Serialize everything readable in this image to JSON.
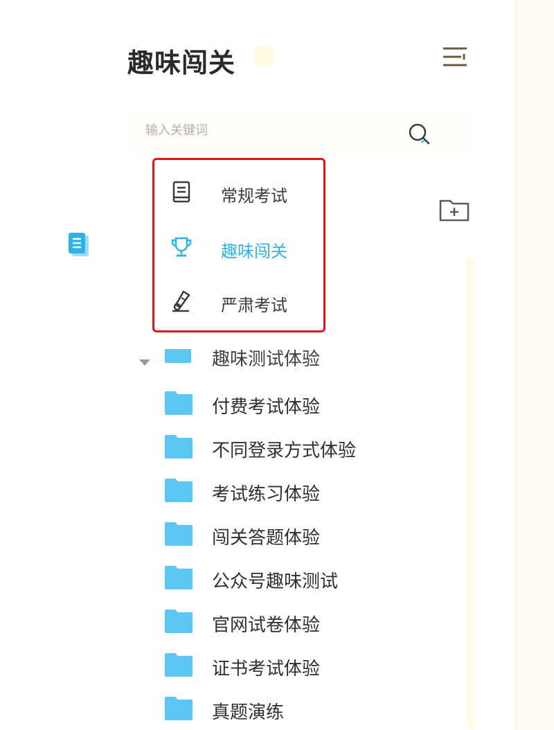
{
  "header": {
    "title": "趣味闯关"
  },
  "search": {
    "placeholder": "输入关键词"
  },
  "colors": {
    "accent": "#2cb3ea",
    "highlight_border": "#e1141b",
    "folder": "#5cc6f5",
    "icon_stroke": "#5a4a30"
  },
  "mode_menu": {
    "items": [
      {
        "label": "常规考试",
        "icon": "notebook-icon",
        "active": false
      },
      {
        "label": "趣味闯关",
        "icon": "trophy-icon",
        "active": true
      },
      {
        "label": "严肃考试",
        "icon": "pen-icon",
        "active": false
      }
    ]
  },
  "folders": {
    "parent": {
      "label": "趣味测试体验",
      "expanded": true
    },
    "children": [
      {
        "label": "付费考试体验"
      },
      {
        "label": "不同登录方式体验"
      },
      {
        "label": "考试练习体验"
      },
      {
        "label": "闯关答题体验"
      },
      {
        "label": "公众号趣味测试"
      },
      {
        "label": "官网试卷体验"
      },
      {
        "label": "证书考试体验"
      },
      {
        "label": "真题演练"
      }
    ]
  }
}
